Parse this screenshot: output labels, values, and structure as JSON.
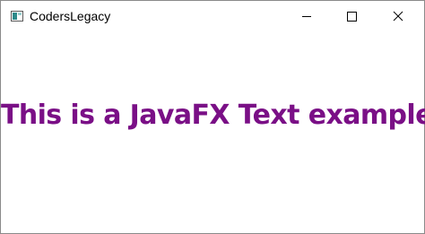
{
  "window": {
    "title": "CodersLegacy",
    "app_icon": "window-app-icon",
    "controls": {
      "minimize_icon": "minimize-icon",
      "maximize_icon": "maximize-icon",
      "close_icon": "close-icon"
    }
  },
  "content": {
    "text": "This is a JavaFX Text example",
    "text_color": "#7a0f86"
  },
  "colors": {
    "window_background": "#ffffff",
    "border": "#8a8a8a",
    "title_text": "#000000",
    "icon_accent": "#2e8b8b"
  }
}
